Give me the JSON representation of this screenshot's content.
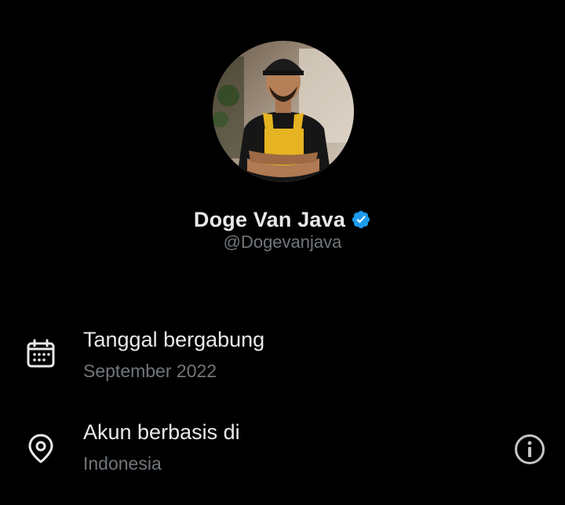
{
  "profile": {
    "display_name": "Doge Van Java",
    "handle": "@Dogevanjava",
    "verified": true
  },
  "about": {
    "joined": {
      "title": "Tanggal bergabung",
      "value": "September 2022",
      "icon": "calendar-icon"
    },
    "location": {
      "title": "Akun berbasis di",
      "value": "Indonesia",
      "icon": "location-pin-icon",
      "action_icon": "info-icon"
    }
  },
  "colors": {
    "background": "#000000",
    "primary_text": "#e7e9ea",
    "secondary_text": "#71767b",
    "verified_badge": "#1d9bf0",
    "icon": "#e7e9ea"
  }
}
